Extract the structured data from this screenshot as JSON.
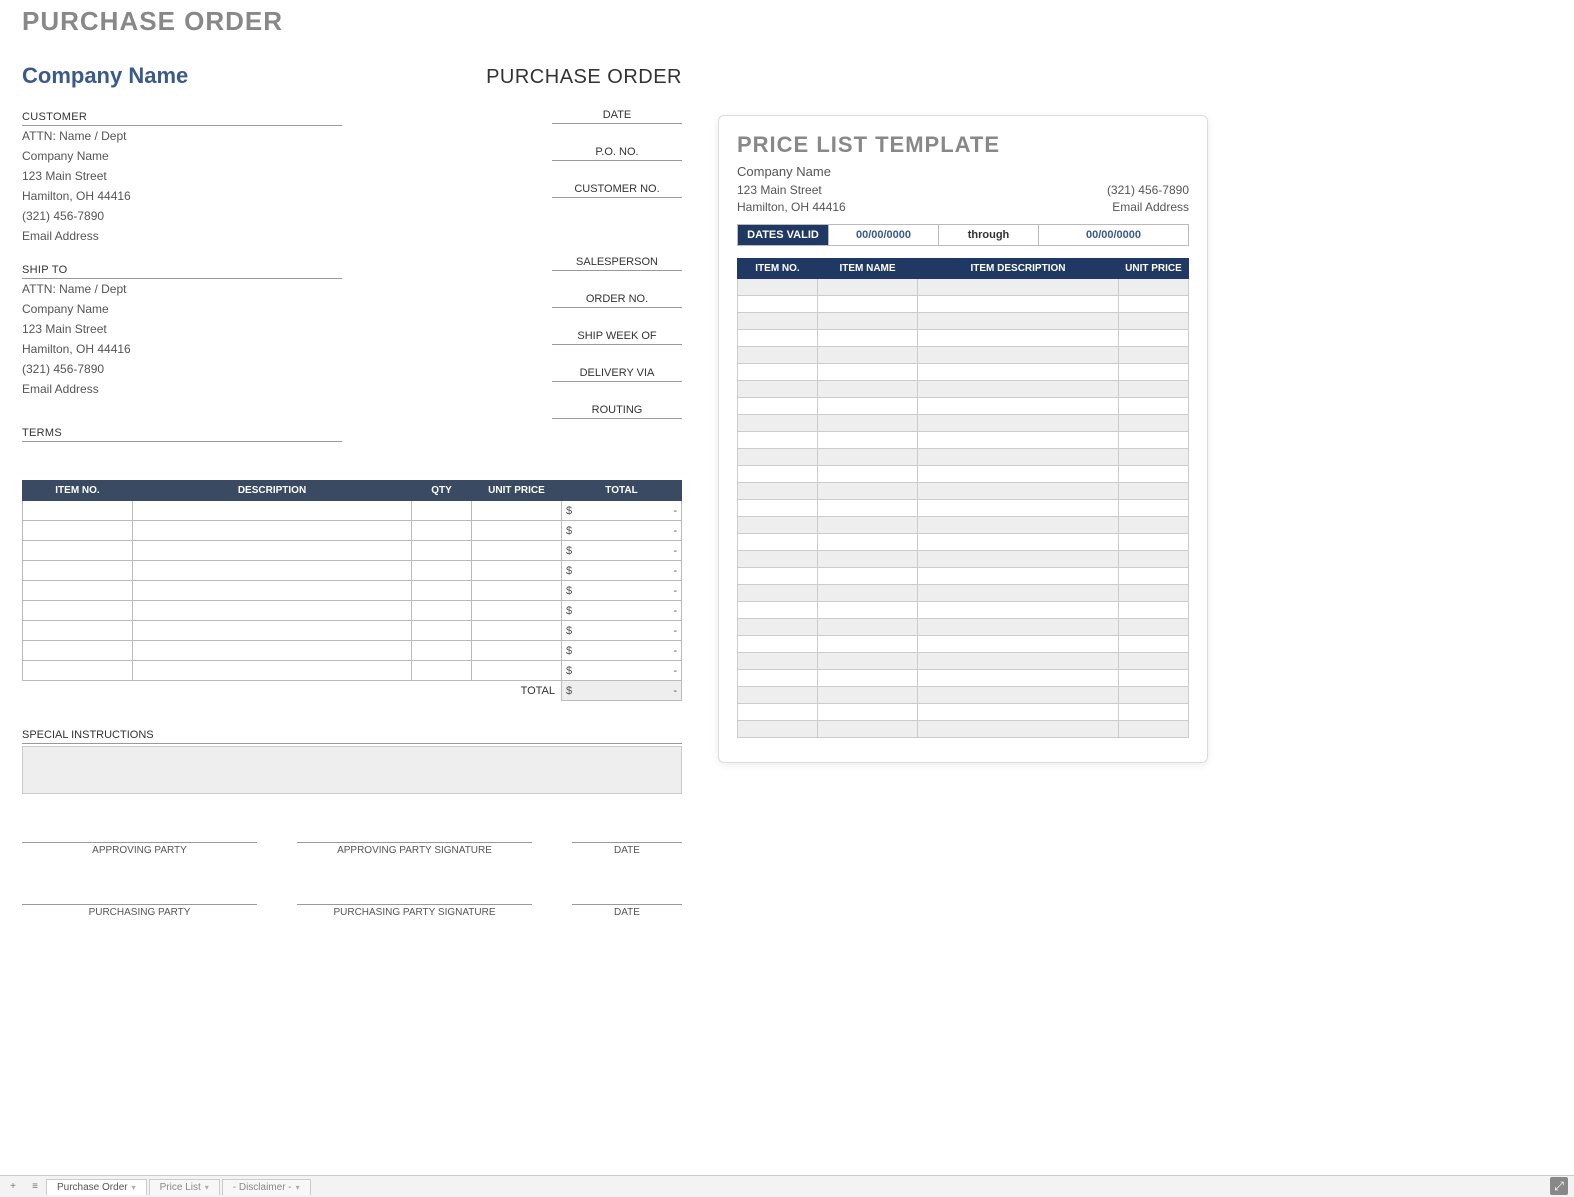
{
  "left": {
    "doc_title": "PURCHASE ORDER",
    "company_name": "Company Name",
    "po_big": "PURCHASE ORDER",
    "customer_label": "CUSTOMER",
    "shipto_label": "SHIP TO",
    "terms_label": "TERMS",
    "customer": {
      "attn": "ATTN: Name / Dept",
      "company": "Company Name",
      "street": "123 Main Street",
      "city": "Hamilton, OH  44416",
      "phone": "(321) 456-7890",
      "email": "Email Address"
    },
    "shipto": {
      "attn": "ATTN: Name / Dept",
      "company": "Company Name",
      "street": "123 Main Street",
      "city": "Hamilton, OH  44416",
      "phone": "(321) 456-7890",
      "email": "Email Address"
    },
    "fields": {
      "date": "DATE",
      "po_no": "P.O. NO.",
      "customer_no": "CUSTOMER NO.",
      "salesperson": "SALESPERSON",
      "order_no": "ORDER NO.",
      "ship_week": "SHIP WEEK OF",
      "delivery_via": "DELIVERY VIA",
      "routing": "ROUTING"
    },
    "table": {
      "headers": {
        "item_no": "ITEM NO.",
        "description": "DESCRIPTION",
        "qty": "QTY",
        "unit_price": "UNIT PRICE",
        "total": "TOTAL"
      },
      "dollar": "$",
      "dash": "-",
      "total_label": "TOTAL",
      "row_count": 9
    },
    "special_label": "SPECIAL INSTRUCTIONS",
    "sig": {
      "approving_party": "APPROVING PARTY",
      "approving_sig": "APPROVING PARTY SIGNATURE",
      "date": "DATE",
      "purchasing_party": "PURCHASING PARTY",
      "purchasing_sig": "PURCHASING PARTY SIGNATURE"
    }
  },
  "right": {
    "title": "PRICE LIST TEMPLATE",
    "company": "Company Name",
    "street": "123 Main Street",
    "city": "Hamilton, OH  44416",
    "phone": "(321) 456-7890",
    "email": "Email Address",
    "dates_valid_label": "DATES VALID",
    "date_from": "00/00/0000",
    "through": "through",
    "date_to": "00/00/0000",
    "headers": {
      "item_no": "ITEM NO.",
      "item_name": "ITEM NAME",
      "item_desc": "ITEM DESCRIPTION",
      "unit_price": "UNIT PRICE"
    },
    "row_count": 27
  },
  "tabs": {
    "t1": "Purchase Order",
    "t2": "Price List",
    "t3": "- Disclaimer -"
  }
}
